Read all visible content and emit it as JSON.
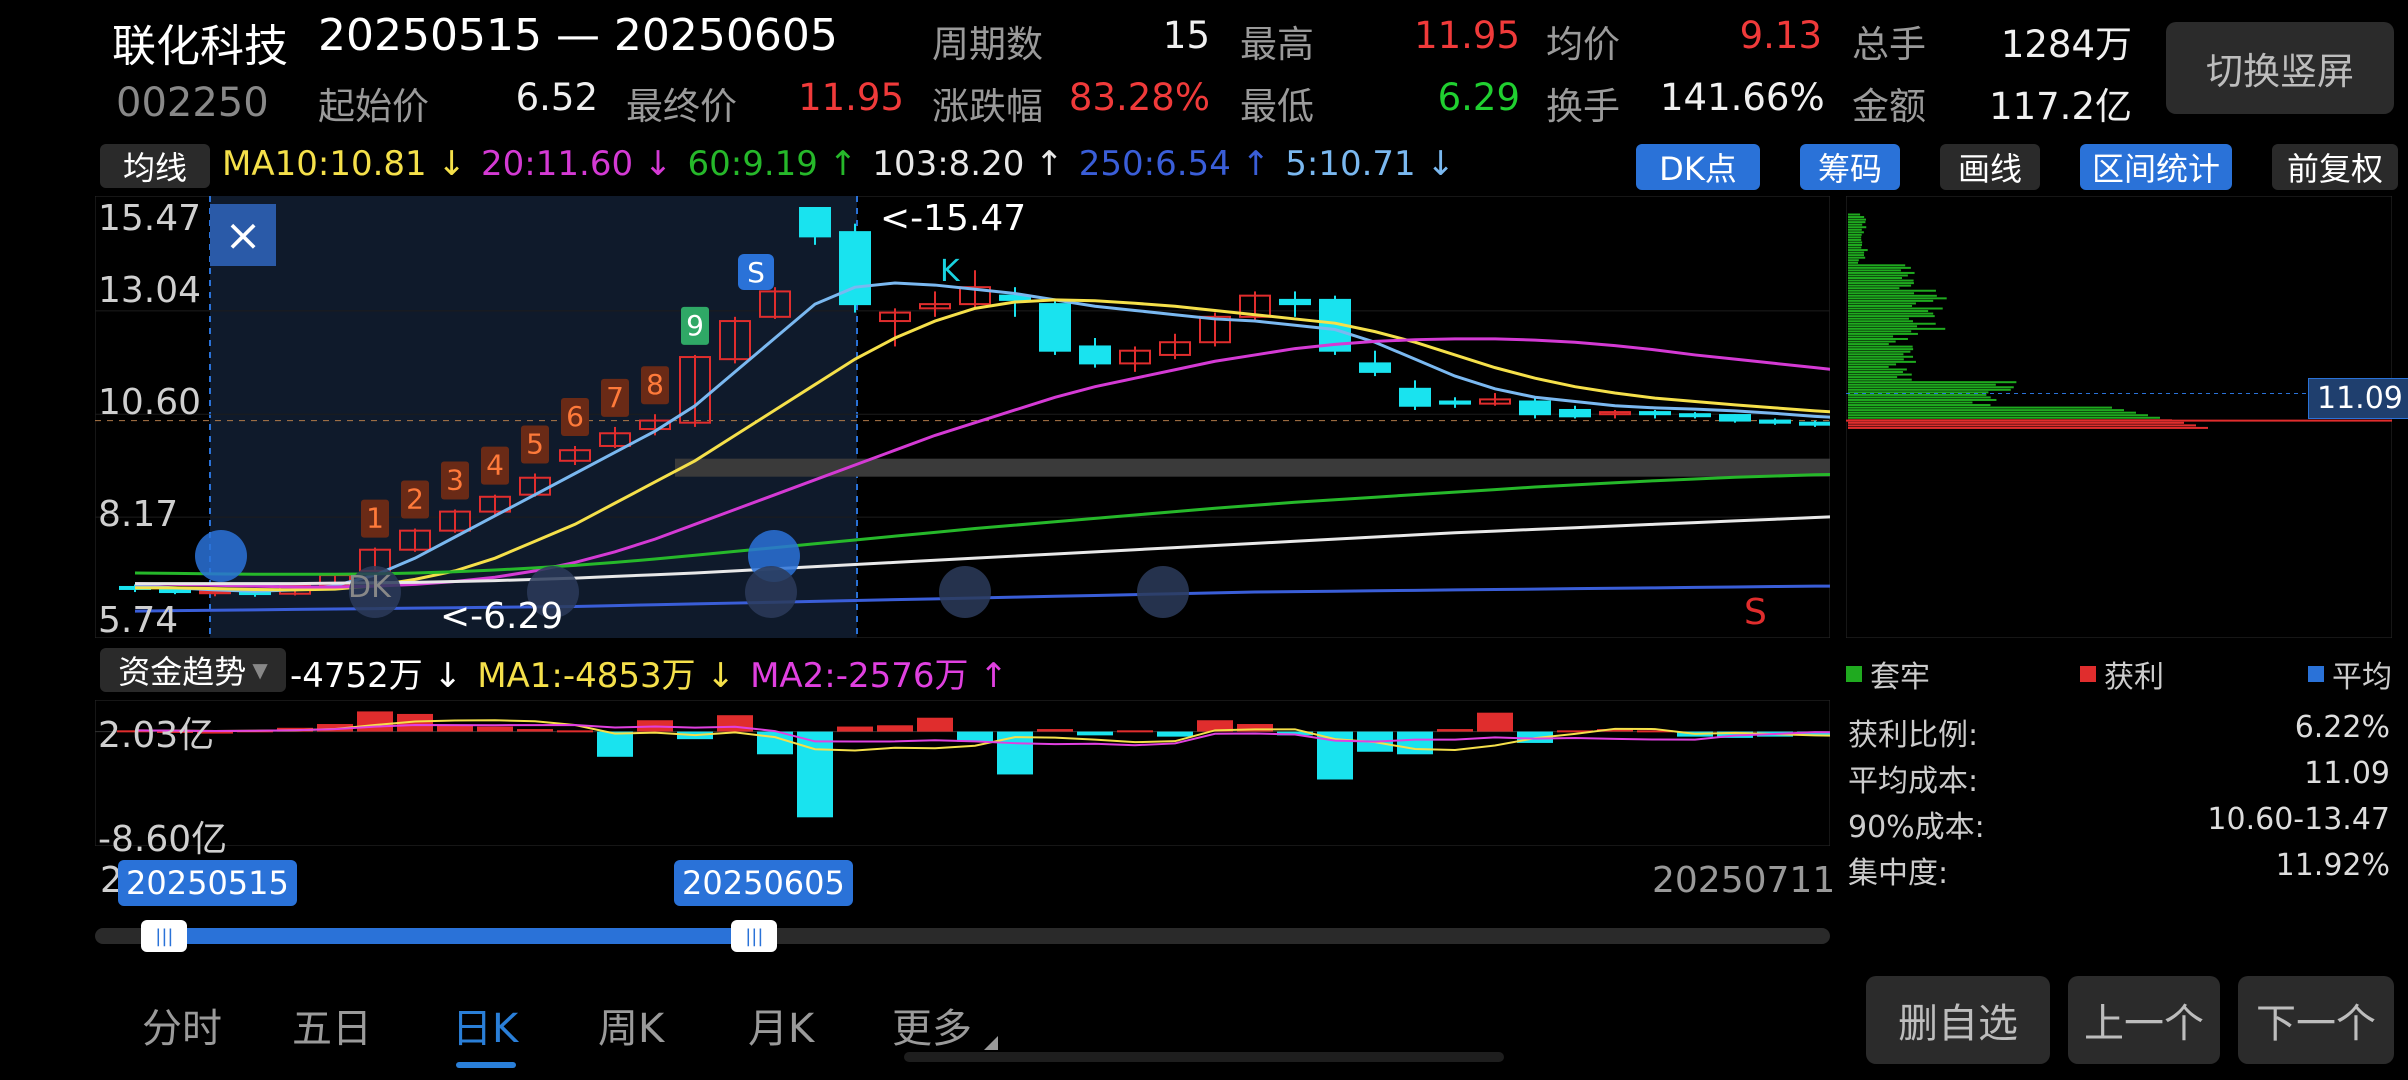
{
  "header": {
    "stock_name": "联化科技",
    "stock_code": "002250",
    "date_range": "20250515 — 20250605",
    "stats": [
      {
        "label": "周期数",
        "value": "15",
        "color": "#f0f0f0"
      },
      {
        "label": "最高",
        "value": "11.95",
        "color": "#f03a3a"
      },
      {
        "label": "均价",
        "value": "9.13",
        "color": "#f03a3a"
      },
      {
        "label": "总手",
        "value": "1284万",
        "color": "#f0f0f0"
      },
      {
        "label": "起始价",
        "value": "6.52",
        "color": "#f0f0f0"
      },
      {
        "label": "最终价",
        "value": "11.95",
        "color": "#f03a3a"
      },
      {
        "label": "涨跌幅",
        "value": "83.28%",
        "color": "#f03a3a"
      },
      {
        "label": "最低",
        "value": "6.29",
        "color": "#20d030"
      },
      {
        "label": "换手",
        "value": "141.66%",
        "color": "#f0f0f0"
      },
      {
        "label": "金额",
        "value": "117.2亿",
        "color": "#f0f0f0"
      }
    ],
    "switch_button": "切换竖屏"
  },
  "ma_bar": {
    "selector": "均线",
    "items": [
      {
        "text": "MA10:10.81 ↓",
        "color": "#f5e04a"
      },
      {
        "text": "20:11.60 ↓",
        "color": "#d43ad4"
      },
      {
        "text": "60:9.19 ↑",
        "color": "#26b82a"
      },
      {
        "text": "103:8.20 ↑",
        "color": "#e8e8e8"
      },
      {
        "text": "250:6.54 ↑",
        "color": "#3a5ed8"
      },
      {
        "text": "5:10.71 ↓",
        "color": "#7ab8f0"
      }
    ],
    "buttons": [
      {
        "label": "DK点",
        "style": "blue"
      },
      {
        "label": "筹码",
        "style": "blue"
      },
      {
        "label": "画线",
        "style": "gray"
      },
      {
        "label": "区间统计",
        "style": "blue"
      },
      {
        "label": "前复权",
        "style": "gray"
      }
    ]
  },
  "main_chart": {
    "y_ticks": [
      "15.47",
      "13.04",
      "10.60",
      "8.17",
      "5.74"
    ],
    "high_annot": "<-15.47",
    "low_annot": "<-6.29",
    "td_counts": [
      "1",
      "2",
      "3",
      "4",
      "5",
      "6",
      "7",
      "8",
      "9"
    ],
    "signal_s_label": "S",
    "signal_k_label": "K",
    "dk_label": "DK",
    "sell_label": "S",
    "close_icon": "×",
    "chip_price_label": "11.09"
  },
  "fund_flow": {
    "selector": "资金趋势",
    "items": [
      {
        "text": "-4752万 ↓",
        "color": "#ffffff"
      },
      {
        "text": "MA1:-4853万 ↓",
        "color": "#f5e04a"
      },
      {
        "text": "MA2:-2576万 ↑",
        "color": "#e040e0"
      }
    ],
    "y_ticks": [
      "2.03亿",
      "-8.60亿"
    ]
  },
  "timeline": {
    "start_tag": "20250515",
    "end_tag": "20250605",
    "last_date": "20250711",
    "left_cut": "2",
    "range_start_fraction": 0.04,
    "range_end_fraction": 0.38
  },
  "chip_panel": {
    "legend": [
      {
        "label": "套牢",
        "color": "#1faa1f"
      },
      {
        "label": "获利",
        "color": "#e02d2d"
      },
      {
        "label": "平均",
        "color": "#2a72d8"
      }
    ],
    "stats": [
      {
        "label": "获利比例:",
        "value": "6.22%"
      },
      {
        "label": "平均成本:",
        "value": "11.09"
      },
      {
        "label": "90%成本:",
        "value": "10.60-13.47"
      },
      {
        "label": "集中度:",
        "value": "11.92%"
      }
    ]
  },
  "tabs": [
    "分时",
    "五日",
    "日K",
    "周K",
    "月K",
    "更多"
  ],
  "active_tab": "日K",
  "bottom_buttons": [
    "删自选",
    "上一个",
    "下一个"
  ],
  "chart_data": {
    "type": "candlestick",
    "ylim": [
      5.74,
      15.47
    ],
    "candles": [
      {
        "o": 6.52,
        "c": 6.48,
        "h": 6.58,
        "l": 6.4
      },
      {
        "o": 6.45,
        "c": 6.4,
        "h": 6.5,
        "l": 6.35
      },
      {
        "o": 6.38,
        "c": 6.42,
        "h": 6.46,
        "l": 6.3
      },
      {
        "o": 6.4,
        "c": 6.36,
        "h": 6.45,
        "l": 6.29
      },
      {
        "o": 6.36,
        "c": 6.55,
        "h": 6.6,
        "l": 6.32
      },
      {
        "o": 6.55,
        "c": 6.8,
        "h": 6.85,
        "l": 6.5
      },
      {
        "o": 6.9,
        "c": 7.4,
        "h": 7.45,
        "l": 6.88
      },
      {
        "o": 7.4,
        "c": 7.85,
        "h": 7.9,
        "l": 7.35
      },
      {
        "o": 7.85,
        "c": 8.3,
        "h": 8.35,
        "l": 7.8
      },
      {
        "o": 8.3,
        "c": 8.65,
        "h": 8.7,
        "l": 8.2
      },
      {
        "o": 8.7,
        "c": 9.1,
        "h": 9.2,
        "l": 8.65
      },
      {
        "o": 9.5,
        "c": 9.75,
        "h": 9.85,
        "l": 9.4
      },
      {
        "o": 9.85,
        "c": 10.15,
        "h": 10.3,
        "l": 9.8
      },
      {
        "o": 10.25,
        "c": 10.45,
        "h": 10.6,
        "l": 10.1
      },
      {
        "o": 10.4,
        "c": 11.95,
        "h": 12.0,
        "l": 10.3
      },
      {
        "o": 11.9,
        "c": 12.8,
        "h": 12.9,
        "l": 11.8
      },
      {
        "o": 12.9,
        "c": 13.5,
        "h": 13.6,
        "l": 12.85
      },
      {
        "o": 15.47,
        "c": 14.8,
        "h": 15.47,
        "l": 14.6
      },
      {
        "o": 14.9,
        "c": 13.2,
        "h": 15.1,
        "l": 13.0
      },
      {
        "o": 12.8,
        "c": 13.0,
        "h": 13.1,
        "l": 12.2
      },
      {
        "o": 13.1,
        "c": 13.2,
        "h": 13.5,
        "l": 12.9
      },
      {
        "o": 13.2,
        "c": 13.6,
        "h": 14.0,
        "l": 13.1
      },
      {
        "o": 13.4,
        "c": 13.3,
        "h": 13.6,
        "l": 12.9
      },
      {
        "o": 13.2,
        "c": 12.1,
        "h": 13.3,
        "l": 12.0
      },
      {
        "o": 12.2,
        "c": 11.8,
        "h": 12.4,
        "l": 11.7
      },
      {
        "o": 11.8,
        "c": 12.1,
        "h": 12.2,
        "l": 11.6
      },
      {
        "o": 12.0,
        "c": 12.3,
        "h": 12.5,
        "l": 11.9
      },
      {
        "o": 12.3,
        "c": 12.9,
        "h": 13.0,
        "l": 12.2
      },
      {
        "o": 12.9,
        "c": 13.4,
        "h": 13.5,
        "l": 12.8
      },
      {
        "o": 13.3,
        "c": 13.2,
        "h": 13.5,
        "l": 12.9
      },
      {
        "o": 13.3,
        "c": 12.1,
        "h": 13.4,
        "l": 12.0
      },
      {
        "o": 11.8,
        "c": 11.6,
        "h": 12.1,
        "l": 11.5
      },
      {
        "o": 11.2,
        "c": 10.8,
        "h": 11.4,
        "l": 10.7
      },
      {
        "o": 10.9,
        "c": 10.85,
        "h": 11.0,
        "l": 10.75
      },
      {
        "o": 10.85,
        "c": 10.95,
        "h": 11.1,
        "l": 10.8
      },
      {
        "o": 10.9,
        "c": 10.6,
        "h": 11.0,
        "l": 10.5
      },
      {
        "o": 10.7,
        "c": 10.55,
        "h": 10.8,
        "l": 10.5
      },
      {
        "o": 10.6,
        "c": 10.65,
        "h": 10.7,
        "l": 10.5
      },
      {
        "o": 10.65,
        "c": 10.6,
        "h": 10.7,
        "l": 10.5
      },
      {
        "o": 10.6,
        "c": 10.58,
        "h": 10.65,
        "l": 10.5
      },
      {
        "o": 10.58,
        "c": 10.45,
        "h": 10.6,
        "l": 10.4
      },
      {
        "o": 10.45,
        "c": 10.4,
        "h": 10.5,
        "l": 10.35
      },
      {
        "o": 10.4,
        "c": 10.38,
        "h": 10.45,
        "l": 10.3
      },
      {
        "o": 10.38,
        "c": 10.3,
        "h": 10.4,
        "l": 10.25
      }
    ],
    "ma_series": [
      {
        "name": "MA5",
        "color": "#7ab8f0",
        "values": [
          6.55,
          6.5,
          6.45,
          6.42,
          6.45,
          6.55,
          6.8,
          7.2,
          7.7,
          8.2,
          8.7,
          9.2,
          9.7,
          10.2,
          10.8,
          11.6,
          12.4,
          13.2,
          13.6,
          13.7,
          13.65,
          13.55,
          13.45,
          13.3,
          13.15,
          13.05,
          12.95,
          12.85,
          12.8,
          12.7,
          12.6,
          12.3,
          11.9,
          11.5,
          11.2,
          11.0,
          10.9,
          10.8,
          10.75,
          10.72,
          10.68,
          10.62,
          10.55,
          10.5
        ]
      },
      {
        "name": "MA10",
        "color": "#f5e04a",
        "values": [
          6.5,
          6.5,
          6.48,
          6.46,
          6.45,
          6.47,
          6.55,
          6.7,
          6.9,
          7.2,
          7.6,
          8.0,
          8.5,
          9.0,
          9.5,
          10.1,
          10.7,
          11.3,
          11.9,
          12.4,
          12.8,
          13.1,
          13.25,
          13.3,
          13.28,
          13.22,
          13.15,
          13.05,
          12.95,
          12.85,
          12.75,
          12.55,
          12.3,
          12.0,
          11.7,
          11.45,
          11.25,
          11.1,
          10.98,
          10.9,
          10.82,
          10.75,
          10.68,
          10.62
        ]
      },
      {
        "name": "MA20",
        "color": "#d43ad4",
        "values": [
          6.6,
          6.58,
          6.56,
          6.54,
          6.52,
          6.52,
          6.54,
          6.58,
          6.65,
          6.75,
          6.9,
          7.1,
          7.35,
          7.65,
          8.0,
          8.35,
          8.7,
          9.05,
          9.4,
          9.75,
          10.1,
          10.4,
          10.7,
          11.0,
          11.25,
          11.45,
          11.65,
          11.85,
          12.0,
          12.15,
          12.25,
          12.32,
          12.36,
          12.38,
          12.38,
          12.35,
          12.3,
          12.22,
          12.12,
          12.0,
          11.9,
          11.8,
          11.7,
          11.6
        ]
      },
      {
        "name": "MA60",
        "color": "#26b82a",
        "values": [
          6.85,
          6.84,
          6.83,
          6.82,
          6.82,
          6.82,
          6.83,
          6.85,
          6.88,
          6.92,
          6.97,
          7.03,
          7.1,
          7.18,
          7.27,
          7.36,
          7.45,
          7.54,
          7.63,
          7.72,
          7.81,
          7.9,
          7.98,
          8.06,
          8.14,
          8.22,
          8.3,
          8.38,
          8.45,
          8.52,
          8.58,
          8.64,
          8.7,
          8.76,
          8.82,
          8.88,
          8.93,
          8.98,
          9.03,
          9.07,
          9.11,
          9.14,
          9.17,
          9.19
        ]
      },
      {
        "name": "MA103",
        "color": "#e8e8e8",
        "values": [
          6.6,
          6.6,
          6.6,
          6.6,
          6.6,
          6.61,
          6.62,
          6.63,
          6.65,
          6.67,
          6.7,
          6.73,
          6.77,
          6.81,
          6.85,
          6.9,
          6.95,
          7.0,
          7.05,
          7.1,
          7.15,
          7.2,
          7.25,
          7.3,
          7.35,
          7.4,
          7.45,
          7.5,
          7.55,
          7.6,
          7.65,
          7.7,
          7.75,
          7.8,
          7.84,
          7.88,
          7.92,
          7.96,
          8.0,
          8.04,
          8.08,
          8.12,
          8.16,
          8.2
        ]
      },
      {
        "name": "MA250",
        "color": "#3a5ed8",
        "values": [
          5.95,
          5.96,
          5.97,
          5.98,
          5.99,
          6.0,
          6.01,
          6.02,
          6.03,
          6.04,
          6.05,
          6.06,
          6.08,
          6.1,
          6.12,
          6.14,
          6.16,
          6.18,
          6.2,
          6.22,
          6.24,
          6.26,
          6.28,
          6.3,
          6.32,
          6.34,
          6.36,
          6.38,
          6.4,
          6.41,
          6.42,
          6.43,
          6.44,
          6.45,
          6.46,
          6.47,
          6.48,
          6.49,
          6.5,
          6.51,
          6.52,
          6.53,
          6.54,
          6.54
        ]
      }
    ],
    "fund_flow_values": [
      0.1,
      0.05,
      0.0,
      0.1,
      0.3,
      0.6,
      1.6,
      1.4,
      0.5,
      0.4,
      0.2,
      0.1,
      -2.0,
      0.9,
      -0.6,
      1.3,
      -1.8,
      -6.8,
      0.4,
      0.5,
      1.1,
      -0.8,
      -3.4,
      0.2,
      -0.3,
      0.1,
      -0.4,
      0.9,
      0.6,
      -0.3,
      -3.8,
      -1.6,
      -1.8,
      0.2,
      1.5,
      -0.9,
      0.1,
      0.2,
      0.1,
      -0.4,
      -0.5,
      -0.4,
      -0.3,
      -0.2
    ],
    "fund_ylim": [
      -8.6,
      2.03
    ]
  }
}
